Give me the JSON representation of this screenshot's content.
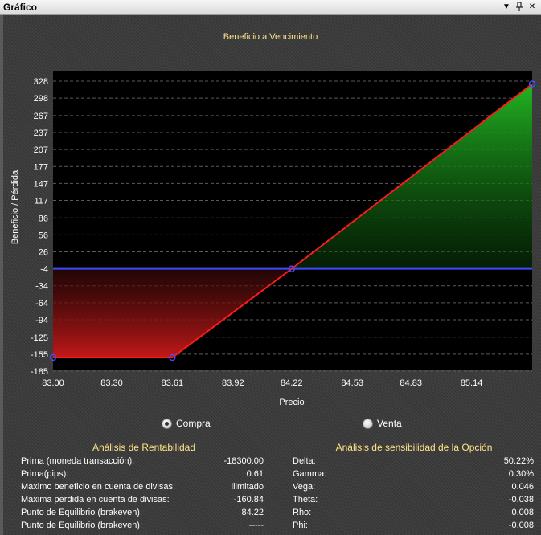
{
  "window": {
    "title": "Gráfico",
    "icons": [
      "dropdown-arrow-icon",
      "pin-icon",
      "close-icon"
    ]
  },
  "colors": {
    "plot_bg": "#000000",
    "payoff_line": "#ff1a1a",
    "zero_line": "#3b4bff",
    "profit_fill": "#22b522",
    "loss_fill": "#c21818",
    "label_color": "#ffe48a"
  },
  "chart_data": {
    "type": "line",
    "title": "Beneficio a Vencimiento",
    "xlabel": "Precio",
    "ylabel": "Beneficio / Pérdida",
    "x_ticks": [
      "83.00",
      "83.30",
      "83.61",
      "83.92",
      "84.22",
      "84.53",
      "84.83",
      "85.14"
    ],
    "y_ticks": [
      "328",
      "298",
      "267",
      "237",
      "207",
      "177",
      "147",
      "117",
      "86",
      "56",
      "26",
      "-4",
      "-34",
      "-64",
      "-94",
      "-125",
      "-155",
      "-185"
    ],
    "xlim": [
      83.0,
      85.45
    ],
    "ylim": [
      -185,
      328
    ],
    "zero_line_y": -4,
    "grid": true,
    "series": [
      {
        "x": [
          83.0,
          83.61,
          84.22,
          85.45
        ],
        "y": [
          -160.84,
          -160.84,
          -4,
          323
        ]
      }
    ]
  },
  "options": {
    "compra_label": "Compra",
    "compra_selected": true,
    "venta_label": "Venta",
    "venta_selected": false
  },
  "rentabilidad": {
    "title": "Análisis de Rentabilidad",
    "rows": [
      {
        "label": "Prima (moneda transacción):",
        "value": "-18300.00"
      },
      {
        "label": "Prima(pips):",
        "value": "0.61"
      },
      {
        "label": "Maximo beneficio en cuenta de divisas:",
        "value": "ilimitado"
      },
      {
        "label": "Maxima perdida en cuenta de divisas:",
        "value": "-160.84"
      },
      {
        "label": "Punto de Equilibrio (brakeven):",
        "value": "84.22"
      },
      {
        "label": "Punto de Equilibrio (brakeven):",
        "value": "-----"
      }
    ]
  },
  "sensibilidad": {
    "title": "Análisis de sensibilidad de la Opción",
    "rows": [
      {
        "label": "Delta:",
        "value": "50.22%"
      },
      {
        "label": "Gamma:",
        "value": "0.30%"
      },
      {
        "label": "Vega:",
        "value": "0.046"
      },
      {
        "label": "Theta:",
        "value": "-0.038"
      },
      {
        "label": "Rho:",
        "value": "0.008"
      },
      {
        "label": "Phi:",
        "value": "-0.008"
      }
    ]
  }
}
